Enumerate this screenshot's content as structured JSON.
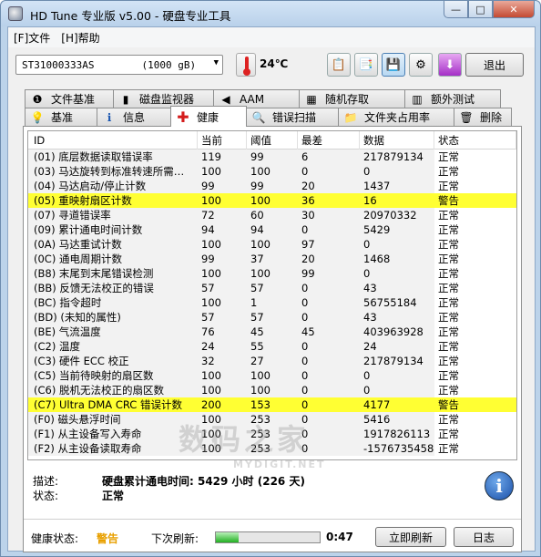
{
  "window": {
    "title": "HD Tune 专业版 v5.00 - 硬盘专业工具",
    "controls": {
      "minimize": "—",
      "maximize": "□",
      "close": "✕"
    }
  },
  "menu": [
    "[F]文件",
    "[H]帮助"
  ],
  "toolbar": {
    "drive": "ST31000333AS",
    "drive_size": "(1000 gB)",
    "temperature": "24℃",
    "exit_label": "退出",
    "icons": [
      "copy-text-icon",
      "copy-screen-icon",
      "save-icon",
      "options-icon",
      "download-icon"
    ]
  },
  "tabs_top": [
    {
      "label": "文件基准",
      "icon": "file-benchmark-icon",
      "glyph": "❶"
    },
    {
      "label": "磁盘监视器",
      "icon": "disk-monitor-icon",
      "glyph": "▮"
    },
    {
      "label": "AAM",
      "icon": "speaker-icon",
      "glyph": "◀"
    },
    {
      "label": "随机存取",
      "icon": "random-access-icon",
      "glyph": "▦"
    },
    {
      "label": "额外测试",
      "icon": "extra-tests-icon",
      "glyph": "▥"
    }
  ],
  "tabs_bottom": [
    {
      "label": "基准",
      "icon": "benchmark-icon",
      "glyph": "💡"
    },
    {
      "label": "信息",
      "icon": "info-icon",
      "glyph": "ℹ"
    },
    {
      "label": "健康",
      "icon": "health-icon",
      "glyph": "✚",
      "selected": true
    },
    {
      "label": "错误扫描",
      "icon": "error-scan-icon",
      "glyph": "🔍"
    },
    {
      "label": "文件夹占用率",
      "icon": "folder-usage-icon",
      "glyph": "📁"
    },
    {
      "label": "删除",
      "icon": "erase-icon",
      "glyph": "🗑"
    }
  ],
  "table": {
    "headers": {
      "id": "ID",
      "current": "当前",
      "threshold": "阈值",
      "worst": "最差",
      "data": "数据",
      "status": "状态"
    },
    "rows": [
      {
        "id": "(01) 底层数据读取错误率",
        "current": "119",
        "threshold": "99",
        "worst": "6",
        "data": "217879134",
        "status": "正常"
      },
      {
        "id": "(03) 马达旋转到标准转速所需…",
        "current": "100",
        "threshold": "100",
        "worst": "0",
        "data": "0",
        "status": "正常"
      },
      {
        "id": "(04) 马达启动/停止计数",
        "current": "99",
        "threshold": "99",
        "worst": "20",
        "data": "1437",
        "status": "正常"
      },
      {
        "id": "(05) 重映射扇区计数",
        "current": "100",
        "threshold": "100",
        "worst": "36",
        "data": "16",
        "status": "警告",
        "warn": true
      },
      {
        "id": "(07) 寻道错误率",
        "current": "72",
        "threshold": "60",
        "worst": "30",
        "data": "20970332",
        "status": "正常"
      },
      {
        "id": "(09) 累计通电时间计数",
        "current": "94",
        "threshold": "94",
        "worst": "0",
        "data": "5429",
        "status": "正常"
      },
      {
        "id": "(0A) 马达重试计数",
        "current": "100",
        "threshold": "100",
        "worst": "97",
        "data": "0",
        "status": "正常"
      },
      {
        "id": "(0C) 通电周期计数",
        "current": "99",
        "threshold": "37",
        "worst": "20",
        "data": "1468",
        "status": "正常"
      },
      {
        "id": "(B8) 末尾到末尾错误检测",
        "current": "100",
        "threshold": "100",
        "worst": "99",
        "data": "0",
        "status": "正常"
      },
      {
        "id": "(BB) 反馈无法校正的错误",
        "current": "57",
        "threshold": "57",
        "worst": "0",
        "data": "43",
        "status": "正常"
      },
      {
        "id": "(BC) 指令超时",
        "current": "100",
        "threshold": "1",
        "worst": "0",
        "data": "56755184",
        "status": "正常"
      },
      {
        "id": "(BD) (未知的属性)",
        "current": "57",
        "threshold": "57",
        "worst": "0",
        "data": "43",
        "status": "正常"
      },
      {
        "id": "(BE) 气流温度",
        "current": "76",
        "threshold": "45",
        "worst": "45",
        "data": "403963928",
        "status": "正常"
      },
      {
        "id": "(C2) 温度",
        "current": "24",
        "threshold": "55",
        "worst": "0",
        "data": "24",
        "status": "正常"
      },
      {
        "id": "(C3) 硬件 ECC 校正",
        "current": "32",
        "threshold": "27",
        "worst": "0",
        "data": "217879134",
        "status": "正常"
      },
      {
        "id": "(C5) 当前待映射的扇区数",
        "current": "100",
        "threshold": "100",
        "worst": "0",
        "data": "0",
        "status": "正常"
      },
      {
        "id": "(C6) 脱机无法校正的扇区数",
        "current": "100",
        "threshold": "100",
        "worst": "0",
        "data": "0",
        "status": "正常"
      },
      {
        "id": "(C7) Ultra DMA CRC 错误计数",
        "current": "200",
        "threshold": "153",
        "worst": "0",
        "data": "4177",
        "status": "警告",
        "warn": true
      },
      {
        "id": "(F0) 磁头悬浮时间",
        "current": "100",
        "threshold": "253",
        "worst": "0",
        "data": "5416",
        "status": "正常"
      },
      {
        "id": "(F1) 从主设备写入寿命",
        "current": "100",
        "threshold": "253",
        "worst": "0",
        "data": "1917826113",
        "status": "正常"
      },
      {
        "id": "(F2) 从主设备读取寿命",
        "current": "100",
        "threshold": "253",
        "worst": "0",
        "data": "-1576735458",
        "status": "正常"
      }
    ]
  },
  "info": {
    "desc_label": "描述:",
    "desc_value": "硬盘累计通电时间: 5429 小时 (226 天)",
    "state_label": "状态:",
    "state_value": "正常"
  },
  "status": {
    "health_label": "健康状态:",
    "health_value": "警告",
    "next_refresh_label": "下次刷新:",
    "progress": 0.22,
    "countdown": "0:47",
    "refresh_button": "立即刷新",
    "log_button": "日志"
  },
  "watermark": {
    "main": "数码之家",
    "sub": "MYDIGIT.NET"
  },
  "colors": {
    "warn_row": "#ffff33",
    "warn_text": "#e8a000",
    "selected_tab_icon": "#d41c1c"
  }
}
